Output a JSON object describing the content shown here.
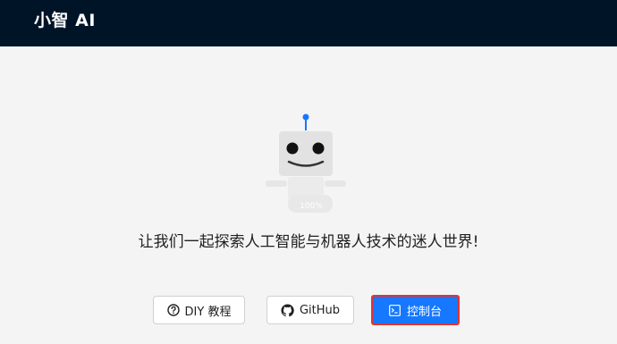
{
  "header": {
    "brand": "小智 AI"
  },
  "hero": {
    "robot_badge": "100%",
    "tagline": "让我们一起探索人工智能与机器人技术的迷人世界!"
  },
  "actions": {
    "diy_label": "DIY 教程",
    "github_label": "GitHub",
    "console_label": "控制台"
  },
  "colors": {
    "header_bg": "#001428",
    "page_bg": "#f4f4f4",
    "primary": "#1677ff",
    "robot_antenna": "#1677ff",
    "highlight_border": "#e8312f"
  }
}
